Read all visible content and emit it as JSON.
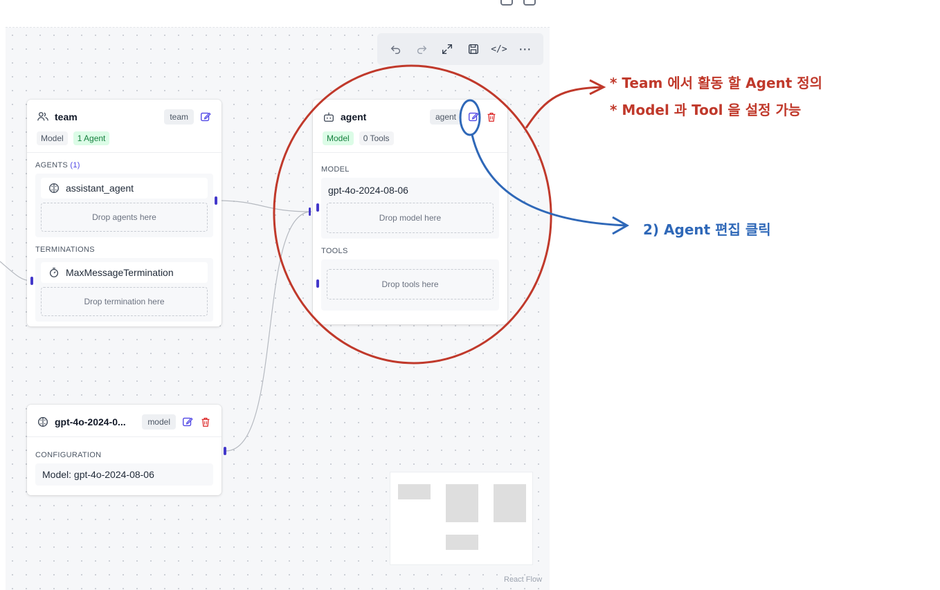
{
  "toolbar": {
    "undo": "undo-icon",
    "redo": "redo-icon",
    "fit": "expand-icon",
    "save": "save-icon",
    "code": "</>",
    "more": "⋯"
  },
  "team_node": {
    "title": "team",
    "badge": "team",
    "chips": [
      "Model",
      "1 Agent"
    ],
    "agents_label": "AGENTS",
    "agents_count": "(1)",
    "agent_item": "assistant_agent",
    "agents_drop": "Drop agents here",
    "terminations_label": "TERMINATIONS",
    "termination_item": "MaxMessageTermination",
    "termination_drop": "Drop termination here"
  },
  "agent_node": {
    "title": "agent",
    "badge": "agent",
    "chips": [
      "Model",
      "0 Tools"
    ],
    "model_label": "MODEL",
    "model_item": "gpt-4o-2024-08-06",
    "model_drop": "Drop model here",
    "tools_label": "TOOLS",
    "tools_drop": "Drop tools here"
  },
  "model_node": {
    "title": "gpt-4o-2024-0...",
    "badge": "model",
    "config_label": "CONFIGURATION",
    "config_value": "Model: gpt-4o-2024-08-06"
  },
  "footer": {
    "react_flow": "React Flow"
  },
  "annotations": {
    "red_line1": "* Team 에서 활동 할 Agent 정의",
    "red_line2": "* Model 과 Tool 을 설정 가능",
    "blue": "2) Agent 편집 클릭"
  },
  "colors": {
    "accent": "#4f46e5",
    "delete": "#dc2626",
    "annotation_red": "#c0392b",
    "annotation_blue": "#2f68b8"
  }
}
